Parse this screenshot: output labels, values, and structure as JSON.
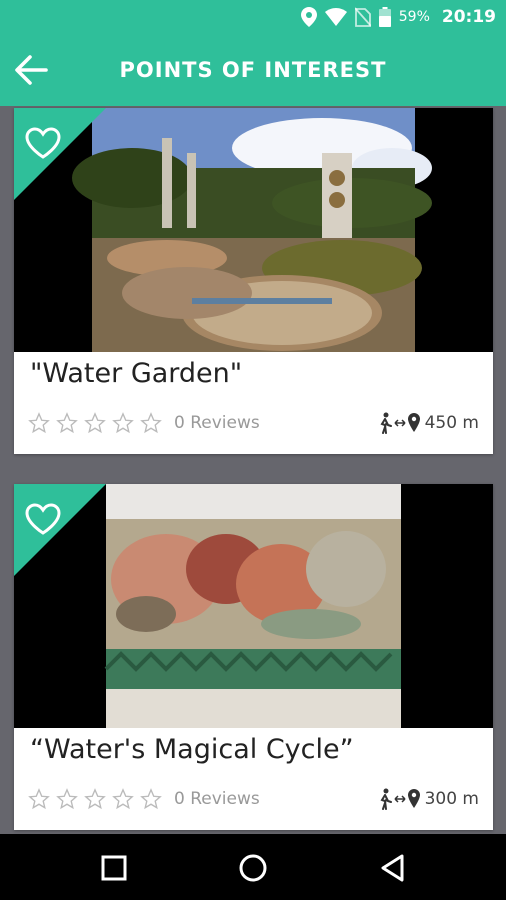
{
  "status": {
    "battery": "59%",
    "time": "20:19"
  },
  "header": {
    "title": "POINTS OF INTEREST"
  },
  "colors": {
    "accent": "#2fbf9a",
    "background": "#66666d"
  },
  "cards": [
    {
      "name": "\"Water Garden\"",
      "reviews": "0 Reviews",
      "distance": "450 m"
    },
    {
      "name": "“Water's Magical Cycle”",
      "reviews": "0 Reviews",
      "distance": "300 m"
    }
  ]
}
